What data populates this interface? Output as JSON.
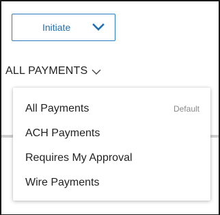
{
  "toolbar": {
    "initiate_label": "Initiate",
    "accent_color": "#1f6fb5"
  },
  "filter": {
    "label": "ALL PAYMENTS"
  },
  "dropdown": {
    "items": [
      {
        "label": "All Payments",
        "badge": "Default",
        "selected": true
      },
      {
        "label": "ACH Payments"
      },
      {
        "label": "Requires My Approval"
      },
      {
        "label": "Wire Payments"
      }
    ]
  }
}
